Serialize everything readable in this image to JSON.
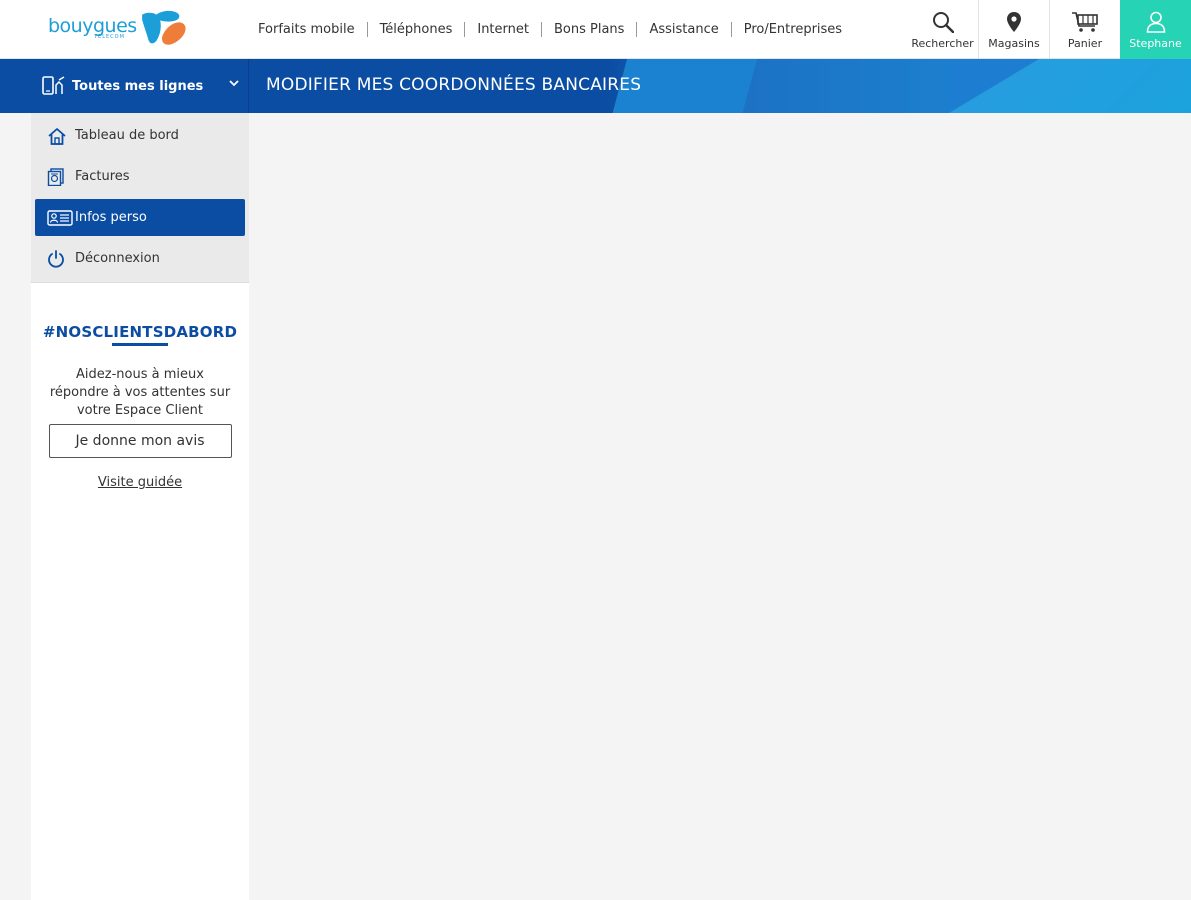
{
  "brand": {
    "name": "bouygues",
    "sub": "TELECOM",
    "colors": {
      "blue": "#1c9fd8",
      "navy": "#0a4da3",
      "orange": "#ef7d3a",
      "teal": "#26d3b4"
    }
  },
  "nav": [
    "Forfaits mobile",
    "Téléphones",
    "Internet",
    "Bons Plans",
    "Assistance",
    "Pro/Entreprises"
  ],
  "actions": {
    "search": {
      "label": "Rechercher",
      "icon": "search-icon"
    },
    "stores": {
      "label": "Magasins",
      "icon": "map-pin-icon"
    },
    "cart": {
      "label": "Panier",
      "icon": "cart-icon"
    },
    "account": {
      "label": "Stephane",
      "icon": "user-icon"
    }
  },
  "lines": {
    "label": "Toutes mes lignes"
  },
  "page": {
    "title": "MODIFIER MES COORDONNÉES BANCAIRES"
  },
  "sidebar": {
    "items": [
      {
        "label": "Tableau de bord",
        "icon": "home-icon"
      },
      {
        "label": "Factures",
        "icon": "invoice-icon"
      },
      {
        "label": "Infos perso",
        "icon": "id-card-icon",
        "active": true
      },
      {
        "label": "Déconnexion",
        "icon": "power-icon"
      }
    ],
    "promo": {
      "hashtag": "#NOSCLIENTSDABORD",
      "text": "Aidez-nous à mieux répondre à vos attentes sur votre Espace Client",
      "button": "Je donne mon avis",
      "link": "Visite guidée"
    }
  }
}
